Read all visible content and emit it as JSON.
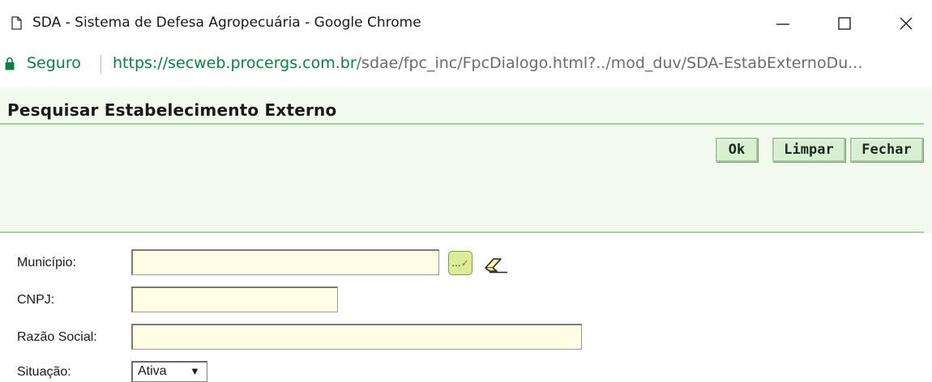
{
  "window": {
    "title": "SDA - Sistema de Defesa Agropecuária - Google Chrome"
  },
  "address_bar": {
    "security_label": "Seguro",
    "url_scheme": "https://",
    "url_host": "secweb.procergs.com.br",
    "url_path": "/sdae/fpc_inc/FpcDialogo.html?../mod_duv/SDA-EstabExternoDu..."
  },
  "dialog": {
    "title": "Pesquisar Estabelecimento Externo",
    "buttons": {
      "ok": "Ok",
      "clear": "Limpar",
      "close": "Fechar"
    }
  },
  "form": {
    "municipio_label": "Município:",
    "municipio_value": "",
    "lookup_label": "...",
    "lookup_check": "✓",
    "cnpj_label": "CNPJ:",
    "cnpj_value": "",
    "razao_label": "Razão Social:",
    "razao_value": "",
    "situacao_label": "Situação:",
    "situacao_selected": "Ativa"
  },
  "colors": {
    "panel_bg": "#f2faee",
    "accent_green": "#0b8043",
    "input_bg": "#fffde3"
  }
}
